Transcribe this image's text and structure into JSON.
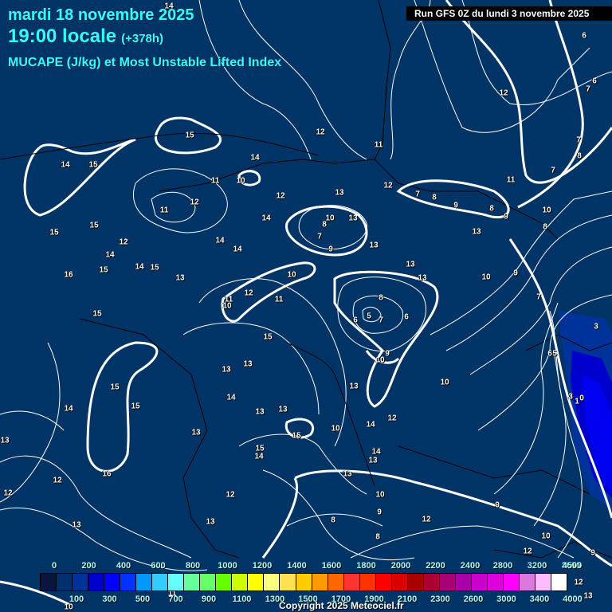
{
  "header": {
    "date": "mardi 18 novembre 2025",
    "time": "19:00 locale",
    "lead": "(+378h)",
    "parameter": "MUCAPE (J/kg) et Most Unstable Lifted Index",
    "run": "Run GFS 0Z du lundi 3 novembre 2025"
  },
  "legend": {
    "top_labels": [
      "0",
      "200",
      "400",
      "600",
      "800",
      "1000",
      "1200",
      "1400",
      "1600",
      "1800",
      "2000",
      "2200",
      "2400",
      "2800",
      "3200",
      "3600",
      "4500"
    ],
    "bottom_labels": [
      "100",
      "300",
      "500",
      "700",
      "900",
      "1100",
      "1300",
      "1500",
      "1700",
      "1900",
      "2100",
      "2300",
      "2600",
      "3000",
      "3400",
      "4000"
    ],
    "colors": [
      "#0a1440",
      "#003070",
      "#003399",
      "#0000cc",
      "#0000ff",
      "#0033ff",
      "#0099ff",
      "#33ccff",
      "#66ffff",
      "#66ff99",
      "#66ff66",
      "#66ff00",
      "#ccff00",
      "#ffff00",
      "#ffff80",
      "#ffe050",
      "#ffcc00",
      "#ff9900",
      "#ff6600",
      "#ff3333",
      "#ff3300",
      "#ff0000",
      "#dd0000",
      "#aa0000",
      "#aa0033",
      "#aa0077",
      "#aa00aa",
      "#cc00cc",
      "#dd00dd",
      "#ff00ff",
      "#dd77dd",
      "#ffbbff",
      "#ffffff"
    ]
  },
  "contour_labels": [
    "14",
    "6",
    "6",
    "7",
    "12",
    "12",
    "15",
    "11",
    "7",
    "8",
    "14",
    "15",
    "14",
    "7",
    "11",
    "10",
    "12",
    "13",
    "12",
    "7",
    "8",
    "9",
    "8",
    "9",
    "11",
    "10",
    "8",
    "12",
    "11",
    "15",
    "14",
    "10",
    "13",
    "8",
    "7",
    "9",
    "13",
    "13",
    "15",
    "12",
    "14",
    "14",
    "14",
    "15",
    "14",
    "15",
    "13",
    "13",
    "13",
    "16",
    "10",
    "9",
    "10",
    "12",
    "11",
    "11",
    "10",
    "8",
    "7",
    "15",
    "6",
    "5",
    "7",
    "6",
    "3",
    "15",
    "9",
    "10",
    "6",
    "5",
    "13",
    "13",
    "10",
    "15",
    "13",
    "3",
    "1",
    "0",
    "14",
    "14",
    "15",
    "13",
    "13",
    "12",
    "14",
    "13",
    "15",
    "10",
    "13",
    "15",
    "14",
    "14",
    "13",
    "16",
    "13",
    "12",
    "12",
    "12",
    "10",
    "9",
    "9",
    "12",
    "13",
    "13",
    "8",
    "8",
    "10",
    "12",
    "9",
    "11",
    "12",
    "13",
    "10"
  ],
  "colors": {
    "background": "#003366",
    "title": "#33ffff"
  },
  "copyright": "Copyright 2025 Meteociel.fr"
}
